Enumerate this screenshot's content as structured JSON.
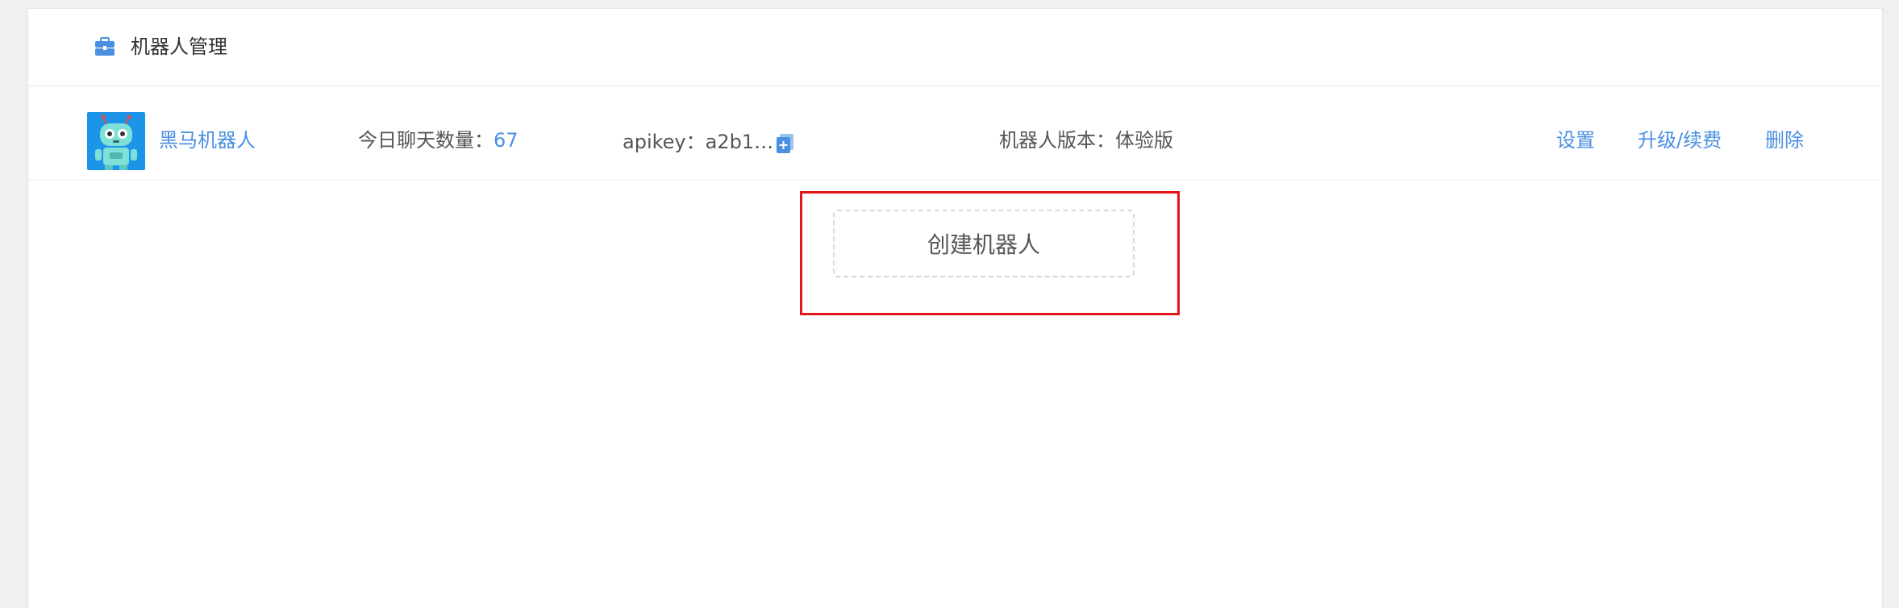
{
  "header": {
    "title": "机器人管理",
    "icon": "briefcase-icon"
  },
  "bot": {
    "name": "黑马机器人",
    "avatar_icon": "robot-avatar-icon",
    "chat_count_label": "今日聊天数量：",
    "chat_count_value": "67",
    "apikey_text": "apikey：a2b1…",
    "copy_icon": "copy-icon",
    "version_text": "机器人版本：体验版",
    "actions": {
      "settings": "设置",
      "upgrade": "升级/续费",
      "delete": "删除"
    }
  },
  "create_button_label": "创建机器人",
  "colors": {
    "link": "#4a90e2",
    "highlight": "#e3141b",
    "text": "#555555"
  }
}
